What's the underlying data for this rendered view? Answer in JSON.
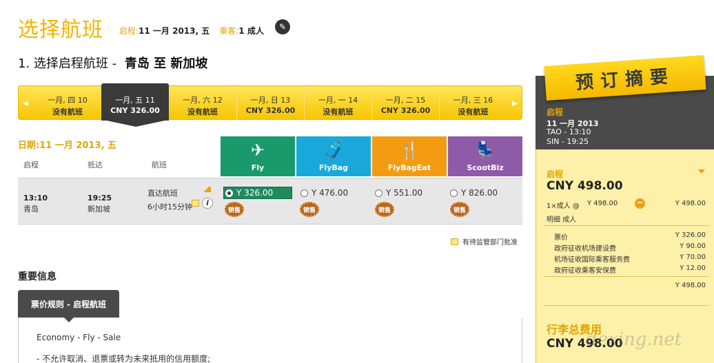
{
  "header": {
    "title": "选择航班",
    "depart_label": "启程:",
    "depart_value": "11 一月 2013, 五",
    "pax_label": "乘客:",
    "pax_value": "1 成人"
  },
  "step": {
    "number": "1.",
    "text": "选择启程航班 -",
    "route": "青岛 至 新加坡"
  },
  "date_strip": [
    {
      "date": "一月, 四 10",
      "price": "没有航班"
    },
    {
      "date": "一月, 五 11",
      "price": "CNY 326.00"
    },
    {
      "date": "一月, 六 12",
      "price": "没有航班"
    },
    {
      "date": "一月, 日 13",
      "price": "CNY 326.00"
    },
    {
      "date": "一月, 一 14",
      "price": "没有航班"
    },
    {
      "date": "一月, 二 15",
      "price": "CNY 326.00"
    },
    {
      "date": "一月, 三 16",
      "price": "没有航班"
    }
  ],
  "date_label": "日期:11 一月 2013, 五",
  "columns": {
    "depart": "启程",
    "arrive": "抵达",
    "flight": "航班"
  },
  "fare_types": [
    {
      "name": "Fly",
      "color": "#1a9a6c"
    },
    {
      "name": "FlyBag",
      "color": "#1aa7d9"
    },
    {
      "name": "FlyBagEat",
      "color": "#f39c12"
    },
    {
      "name": "ScootBiz",
      "color": "#8e5ba8"
    }
  ],
  "flight": {
    "dep_time": "13:10",
    "dep_city": "青岛",
    "arr_time": "19:25",
    "arr_city": "新加坡",
    "type": "直达航班",
    "duration": "6小时15分钟",
    "fares": [
      "Y 326.00",
      "Y 476.00",
      "Y 551.00",
      "Y 826.00"
    ],
    "sale": "销售"
  },
  "pending_note": "有待监管部门批准",
  "important": {
    "heading": "重要信息",
    "tab": "票价规则 - 启程航班",
    "line1": "Economy - Fly - Sale",
    "line2": "- 不允许取消、退票或转为未来抵用的信用额度;"
  },
  "summary": {
    "ribbon": "预订摘要",
    "depart_title": "启程",
    "date": "11 一月 2013",
    "dep": "TAO - 13:10",
    "arr": "SIN - 19:25",
    "fare_title": "启程",
    "fare_total": "CNY 498.00",
    "pax_line": "1×成人 @",
    "pax_price": "Y 498.00",
    "pax_total": "Y 498.00",
    "detail": "明细 成人",
    "breakdown": [
      {
        "label": "票价",
        "value": "Y 326.00"
      },
      {
        "label": "政府征收机场建设费",
        "value": "Y 90.00"
      },
      {
        "label": "机场征收国际乘客服务费",
        "value": "Y 70.00"
      },
      {
        "label": "政府征收乘客安保费",
        "value": "Y 12.00"
      }
    ],
    "breakdown_total": "Y 498.00",
    "bag_title": "行李总费用",
    "bag_total": "CNY 498.00"
  },
  "watermark": "dexing.net"
}
